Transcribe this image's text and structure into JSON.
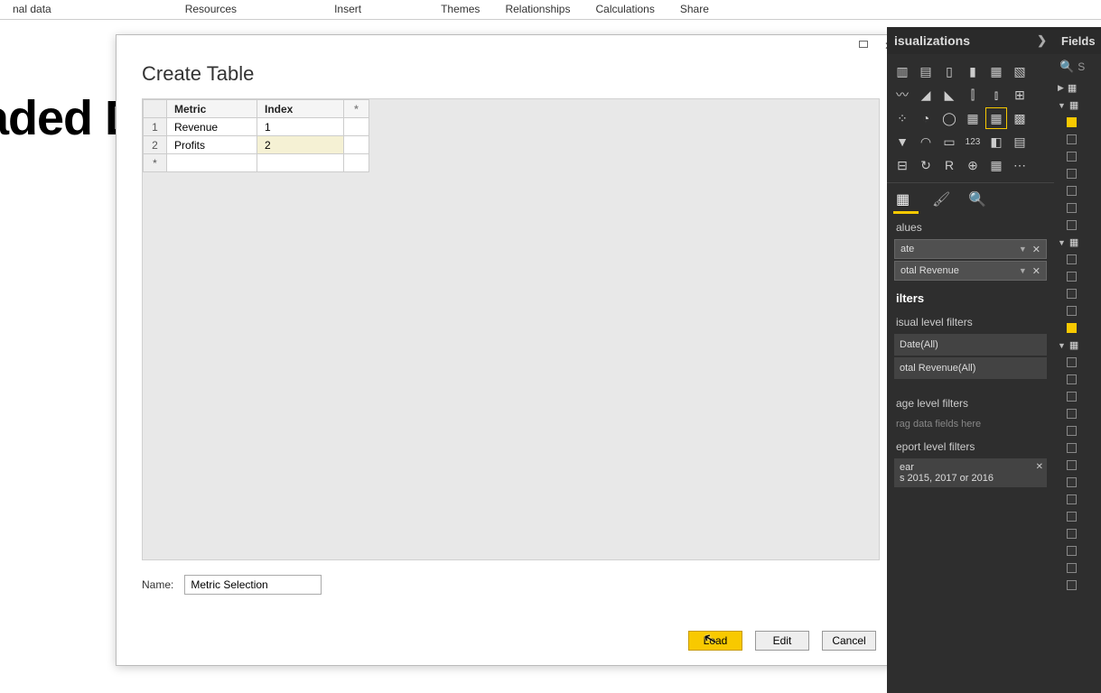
{
  "ribbon": {
    "tabs": [
      "nal data",
      "Resources",
      "Insert",
      "Themes",
      "Relationships",
      "Calculations",
      "Share"
    ]
  },
  "canvas": {
    "bg_text": "aded Dy"
  },
  "dialog": {
    "title": "Create Table",
    "columns": {
      "metric": "Metric",
      "index": "Index",
      "add": "*"
    },
    "rows": [
      {
        "n": "1",
        "metric": "Revenue",
        "index": "1"
      },
      {
        "n": "2",
        "metric": "Profits",
        "index": "2"
      }
    ],
    "new_row_marker": "*",
    "name_label": "Name:",
    "name_value": "Metric Selection",
    "buttons": {
      "load": "Load",
      "edit": "Edit",
      "cancel": "Cancel"
    },
    "win": {
      "max": "▢",
      "close": "✕"
    }
  },
  "viz_panel": {
    "title": "isualizations",
    "expand": "❯",
    "icons": [
      "stacked-bar",
      "clustered-bar",
      "stacked-column",
      "clustered-column",
      "stacked-100",
      "ribbon",
      "line",
      "area",
      "stacked-area",
      "line-clustered",
      "line-stacked",
      "waterfall",
      "scatter",
      "pie",
      "donut",
      "treemap",
      "map",
      "filled-map",
      "funnel",
      "gauge",
      "card",
      "multi-card",
      "kpi",
      "slicer",
      "table",
      "matrix",
      "r-visual",
      "arc-gis",
      "python",
      "custom"
    ],
    "tabs": {
      "fields": "▦",
      "format": "🖌",
      "analytics": "🔍"
    },
    "values_label": "alues",
    "values": [
      {
        "name": "ate"
      },
      {
        "name": "otal Revenue"
      }
    ],
    "filters_label": "ilters",
    "visual_filters_label": "isual level filters",
    "visual_filters": [
      {
        "text": "Date(All)"
      },
      {
        "text": "otal Revenue(All)"
      }
    ],
    "page_filters_label": "age level filters",
    "drop_hint": "rag data fields here",
    "report_filters_label": "eport level filters",
    "report_filter": {
      "line1": "ear",
      "line2": "s 2015, 2017 or 2016"
    }
  },
  "fields_panel": {
    "title": "Fields",
    "search_placeholder": "S"
  }
}
